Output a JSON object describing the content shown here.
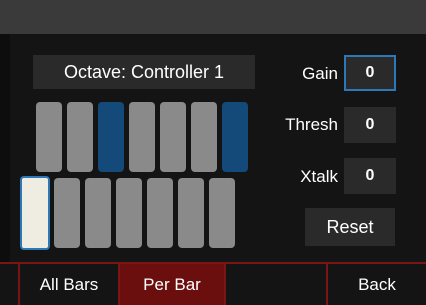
{
  "screen": {
    "title": "Octave: Controller 1"
  },
  "bars": {
    "top_row": [
      {
        "name": "bar-top-1",
        "color": "#8a8a8a"
      },
      {
        "name": "bar-top-2",
        "color": "#8a8a8a"
      },
      {
        "name": "bar-top-3",
        "color": "#134a7a"
      },
      {
        "name": "bar-top-4",
        "color": "#8a8a8a"
      },
      {
        "name": "bar-top-5",
        "color": "#8a8a8a"
      },
      {
        "name": "bar-top-6",
        "color": "#8a8a8a"
      },
      {
        "name": "bar-top-7",
        "color": "#134a7a"
      }
    ],
    "bottom_row": [
      {
        "name": "bar-bottom-1",
        "selected": true
      },
      {
        "name": "bar-bottom-2",
        "selected": false
      },
      {
        "name": "bar-bottom-3",
        "selected": false
      },
      {
        "name": "bar-bottom-4",
        "selected": false
      },
      {
        "name": "bar-bottom-5",
        "selected": false
      },
      {
        "name": "bar-bottom-6",
        "selected": false
      },
      {
        "name": "bar-bottom-7",
        "selected": false
      }
    ]
  },
  "controls": {
    "gain": {
      "label": "Gain",
      "value": "0"
    },
    "thresh": {
      "label": "Thresh",
      "value": "0"
    },
    "xtalk": {
      "label": "Xtalk",
      "value": "0"
    },
    "reset_label": "Reset"
  },
  "bottom_nav": {
    "tabs": [
      {
        "label": "All Bars",
        "selected": false
      },
      {
        "label": "Per Bar",
        "selected": true
      },
      {
        "label": "",
        "selected": false
      },
      {
        "label": "Back",
        "selected": false
      }
    ]
  },
  "colors": {
    "accent_blue": "#2d78b8",
    "nav_red": "#6a0e0e",
    "bar_grey": "#8a8a8a",
    "bar_selected": "#efece1"
  }
}
